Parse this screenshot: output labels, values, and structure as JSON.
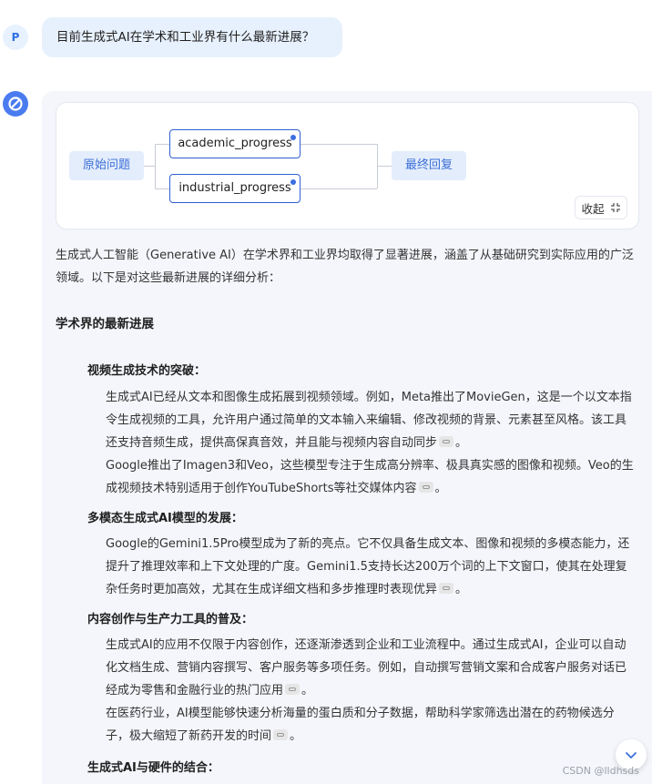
{
  "user": {
    "avatar_letter": "P",
    "question": "目前生成式AI在学术和工业界有什么最新进展？"
  },
  "flow": {
    "start": "原始问题",
    "nodes": [
      "academic_progress",
      "industrial_progress"
    ],
    "end": "最终回复",
    "collapse_label": "收起"
  },
  "answer": {
    "intro": "生成式人工智能（Generative AI）在学术界和工业界均取得了显著进展，涵盖了从基础研究到实际应用的广泛领域。以下是对这些最新进展的详细分析：",
    "section_title": "学术界的最新进展",
    "s1_title": "视频生成技术的突破：",
    "s1_p1": "生成式AI已经从文本和图像生成拓展到视频领域。例如，Meta推出了MovieGen，这是一个以文本指令生成视频的工具，允许用户通过简单的文本输入来编辑、修改视频的背景、元素甚至风格。该工具还支持音频生成，提供高保真音效，并且能与视频内容自动同步",
    "s1_p2": "Google推出了Imagen3和Veo，这些模型专注于生成高分辨率、极具真实感的图像和视频。Veo的生成视频技术特别适用于创作YouTubeShorts等社交媒体内容",
    "s2_title": "多模态生成式AI模型的发展：",
    "s2_p1": "Google的Gemini1.5Pro模型成为了新的亮点。它不仅具备生成文本、图像和视频的多模态能力，还提升了推理效率和上下文处理的广度。Gemini1.5支持长达200万个词的上下文窗口，使其在处理复杂任务时更加高效，尤其在生成详细文档和多步推理时表现优异",
    "s3_title": "内容创作与生产力工具的普及：",
    "s3_p1": "生成式AI的应用不仅限于内容创作，还逐渐渗透到企业和工业流程中。通过生成式AI，企业可以自动化文档生成、营销内容撰写、客户服务等多项任务。例如，自动撰写营销文案和合成客户服务对话已经成为零售和金融行业的热门应用",
    "s3_p2": "在医药行业，AI模型能够快速分析海量的蛋白质和分子数据，帮助科学家筛选出潜在的药物候选分子，极大缩短了新药开发的时间",
    "s4_title": "生成式AI与硬件的结合：",
    "period": "。"
  },
  "watermark": "CSDN @lldhsds"
}
